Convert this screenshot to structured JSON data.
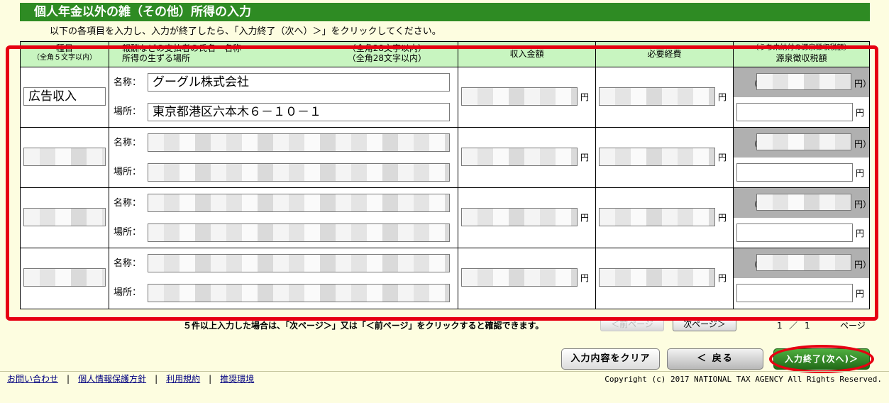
{
  "page": {
    "title": "個人年金以外の雑（その他）所得の入力",
    "instruction": "以下の各項目を入力し、入力が終了したら、「入力終了（次へ）＞」をクリックしてください。"
  },
  "table": {
    "headers": {
      "type": "種目",
      "type_note": "（全角５文字以内）",
      "payer": "報酬などの支払者の氏名・名称",
      "payer_note": "（全角28文字以内）",
      "place": "所得の生ずる場所",
      "place_note": "（全角28文字以内）",
      "income": "収入金額",
      "expense": "必要経費",
      "tax_note": "（うち未納付の源泉徴収税額）",
      "tax": "源泉徴収税額"
    },
    "name_label": "名称：",
    "place_label": "場所：",
    "yen": "円",
    "paren_open": "（",
    "paren_close": "円）",
    "rows": [
      {
        "type": "広告収入",
        "name": "グーグル株式会社",
        "place": "東京都港区六本木６－１０－１"
      },
      {
        "type": "",
        "name": "",
        "place": ""
      },
      {
        "type": "",
        "name": "",
        "place": ""
      },
      {
        "type": "",
        "name": "",
        "place": ""
      }
    ]
  },
  "pager": {
    "note": "５件以上入力した場合は、「次ページ＞」又は「＜前ページ」をクリックすると確認できます。",
    "prev_label": "＜前ページ",
    "next_label": "次ページ＞",
    "current": "1",
    "slash": "／",
    "total": "1",
    "page_word": "ページ"
  },
  "actions": {
    "clear_label": "入力内容をクリア",
    "back_label": "＜ 戻る",
    "finish_label": "入力終了(次へ)＞"
  },
  "footer": {
    "links": [
      "お問い合わせ",
      "個人情報保護方針",
      "利用規約",
      "推奨環境"
    ],
    "copyright": "Copyright (c) 2017 NATIONAL TAX AGENCY All Rights Reserved."
  },
  "colors": {
    "title_bg": "#2e8b23",
    "header_bg": "#c8f5c0",
    "highlight": "#e60012",
    "finish_btn": "#2e8b23"
  }
}
